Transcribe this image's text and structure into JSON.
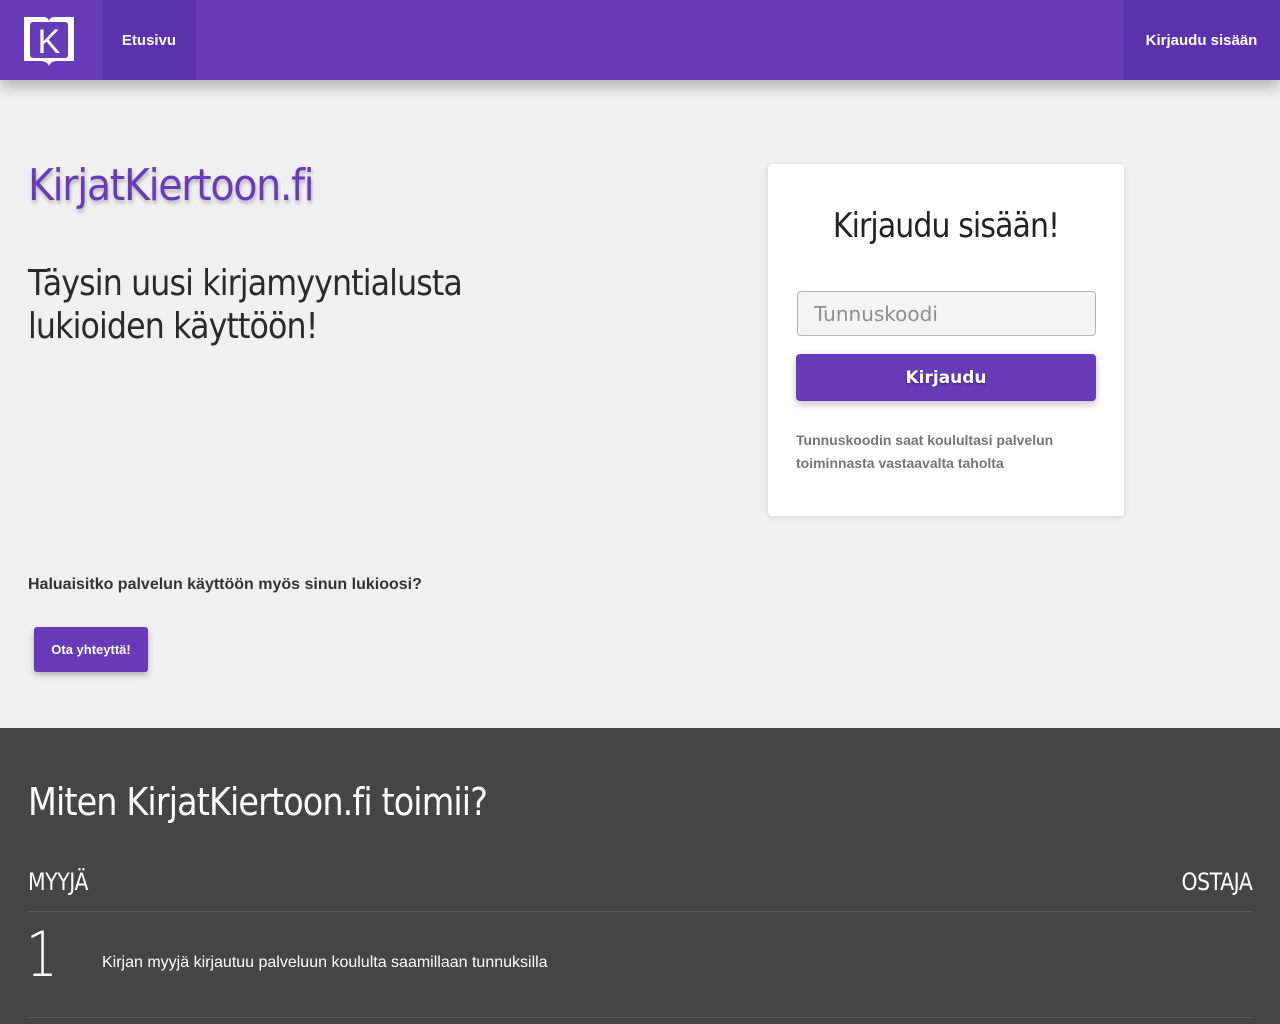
{
  "navbar": {
    "logo_letter": "K",
    "home_label": "Etusivu",
    "login_label": "Kirjaudu sisään"
  },
  "hero": {
    "site_title": "KirjatKiertoon.fi",
    "tagline": "Täysin uusi kirjamyyntialusta lukioiden käyttöön!",
    "question": "Haluaisitko palvelun käyttöön myös sinun lukioosi?",
    "contact_button": "Ota yhteyttä!"
  },
  "login_card": {
    "title": "Kirjaudu sisään!",
    "code_placeholder": "Tunnuskoodi",
    "code_value": "",
    "submit_label": "Kirjaudu",
    "hint": "Tunnuskoodin saat koulultasi palvelun toiminnasta vastaavalta taholta"
  },
  "how_it_works": {
    "title": "Miten KirjatKiertoon.fi toimii?",
    "seller_heading": "MYYJÄ",
    "buyer_heading": "OSTAJA",
    "steps": [
      {
        "number": "1",
        "text": "Kirjan myyjä kirjautuu palveluun koululta saamillaan tunnuksilla"
      }
    ]
  },
  "colors": {
    "brand": "#673ab7",
    "brand_dark": "#5b31ad",
    "page_bg": "#f0f0f0",
    "footer_bg": "#454545"
  }
}
